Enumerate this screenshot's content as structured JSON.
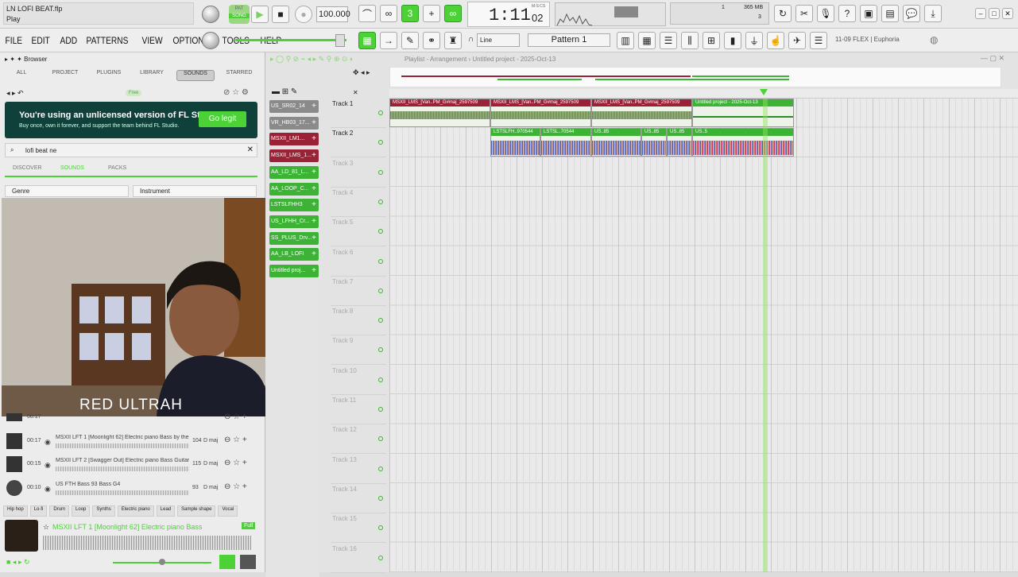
{
  "title": {
    "file": "LN LOFI BEAT.flp",
    "mode": "Play"
  },
  "transport": {
    "pat_label": "PAT",
    "song_label": "SONG",
    "tempo": "100.000",
    "time_main": "1:11",
    "time_sub": "02",
    "time_unit": "M:S:CS",
    "memory": "365 MB",
    "cpu": "3",
    "cpu_slot": "1"
  },
  "menu": [
    "FILE",
    "EDIT",
    "ADD",
    "PATTERNS",
    "VIEW",
    "OPTIONS",
    "TOOLS",
    "HELP"
  ],
  "menubar": {
    "snap": "Line",
    "pattern": "Pattern 1",
    "plugin_info": "11-09  FLEX | Euphoria"
  },
  "browser": {
    "title": "Browser",
    "tabs": [
      "ALL",
      "PROJECT",
      "PLUGINS",
      "LIBRARY",
      "SOUNDS",
      "STARRED"
    ],
    "free_badge": "Free",
    "promo_title": "You're using an unlicensed version of FL Studio.",
    "promo_sub": "Buy once, own it forever, and support the team behind FL Studio.",
    "promo_button": "Go legit",
    "search": "lofi beat ne",
    "subtabs": [
      "DISCOVER",
      "SOUNDS",
      "PACKS"
    ],
    "filter_genre": "Genre",
    "filter_instrument": "Instrument",
    "sounds": [
      {
        "time": "00:17",
        "name": "",
        "bpm": "",
        "key": ""
      },
      {
        "time": "00:17",
        "name": "MSXII LFT 1 [Moonlight 62] Electric piano Bass by the R...",
        "bpm": "104",
        "key": "D maj"
      },
      {
        "time": "00:15",
        "name": "MSXII LFT 2 [Swagger Out] Electric piano Bass Guitar a...",
        "bpm": "115",
        "key": "D maj"
      },
      {
        "time": "00:10",
        "name": "US FTH Bass 93 Bass G4",
        "bpm": "93",
        "key": "D maj"
      }
    ],
    "tags": [
      "Hip hop",
      "Lo-fi",
      "Drum",
      "Loop",
      "Synths",
      "Electric piano",
      "Lead",
      "Sample shape",
      "Vocal"
    ],
    "now_playing": "MSXII LFT 1 [Moonlight 62] Electric piano Bass",
    "now_badge": "Full"
  },
  "webcam": {
    "caption": "RED ULTRAH"
  },
  "playlist": {
    "breadcrumb": "Playlist - Arrangement › Untitled project - 2025-Oct-13",
    "channels": [
      {
        "name": "US_SR02_14",
        "color": "#8a8a8a"
      },
      {
        "name": "VR_HB03_17...",
        "color": "#8a8a8a"
      },
      {
        "name": "MSXII_LM1...",
        "color": "#9b2236"
      },
      {
        "name": "MSXII_LMS_1...",
        "color": "#9b2236"
      },
      {
        "name": "AA_LD_81_L...",
        "color": "#3cb335"
      },
      {
        "name": "AA_LOOP_C...",
        "color": "#3cb335"
      },
      {
        "name": "LSTSLFHH3",
        "color": "#3cb335"
      },
      {
        "name": "US_LFHH_Cr...",
        "color": "#3cb335"
      },
      {
        "name": "SS_PLUS_Drv...",
        "color": "#3cb335"
      },
      {
        "name": "AA_LB_LOFI",
        "color": "#3cb335"
      },
      {
        "name": "Untitled proj...",
        "color": "#3cb335"
      }
    ],
    "tracks": [
      "Track 1",
      "Track 2",
      "Track 3",
      "Track 4",
      "Track 5",
      "Track 6",
      "Track 7",
      "Track 8",
      "Track 9",
      "Track 10",
      "Track 11",
      "Track 12",
      "Track 13",
      "Track 14",
      "Track 15",
      "Track 16"
    ],
    "clips": [
      {
        "label": "MSXII_LMS_[Van..PM_G#maj_2597509",
        "color": "#9b2236"
      },
      {
        "label": "MSXII_LMS_[Van..PM_G#maj_2597509",
        "color": "#9b2236"
      },
      {
        "label": "MSXII_LMS_[Van..PM_G#maj_2597509",
        "color": "#9b2236"
      },
      {
        "label": "MSXII_LMS_[Van..PM_G#maj_2597509",
        "color": "#9b2236"
      },
      {
        "label": "Untitled project - 2025-Oct-13",
        "color": "#3cb335"
      },
      {
        "label": "LSTSLFH..970544",
        "color": "#3cb335"
      },
      {
        "label": "LSTSL..70544",
        "color": "#3cb335"
      },
      {
        "label": "US..85",
        "color": "#3cb335"
      },
      {
        "label": "US..85",
        "color": "#3cb335"
      },
      {
        "label": "US..85",
        "color": "#3cb335"
      },
      {
        "label": "US..5",
        "color": "#3cb335"
      }
    ]
  }
}
